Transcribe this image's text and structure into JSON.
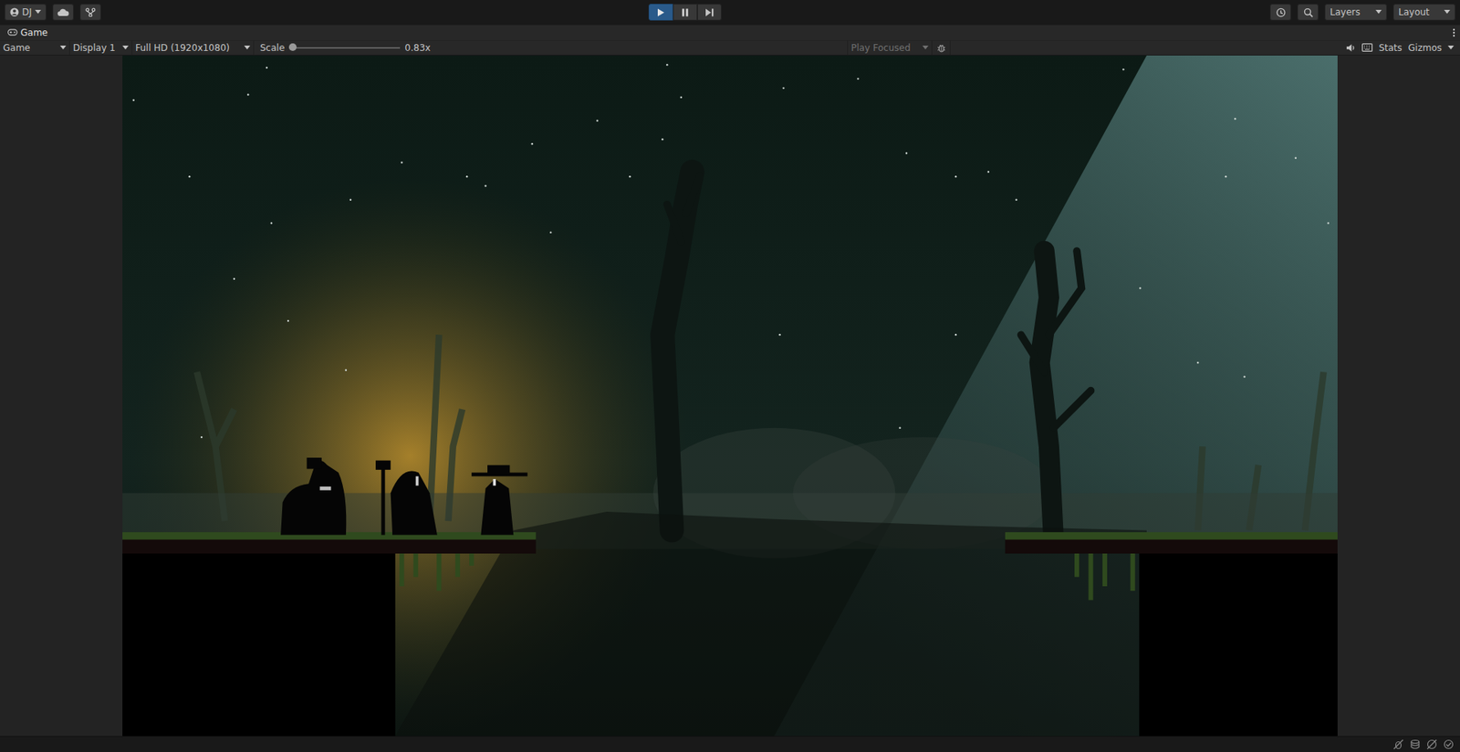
{
  "toolbar": {
    "account": {
      "label": "DJ"
    },
    "play_controls": [
      {
        "kind": "play",
        "selected": true
      },
      {
        "kind": "pause",
        "selected": false
      },
      {
        "kind": "step",
        "selected": false
      }
    ],
    "layers": "Layers",
    "layout": "Layout"
  },
  "tab": {
    "label": "Game",
    "selected": true
  },
  "game_toolbar": {
    "view": "Game",
    "display": "Display 1",
    "resolution": "Full HD (1920x1080)",
    "scale": {
      "label": "Scale",
      "level": 0.0,
      "reading": "0.83x"
    },
    "play_mode": {
      "label": "Play Focused",
      "disabled": true
    },
    "stats": "Stats",
    "gizmos": "Gizmos"
  }
}
